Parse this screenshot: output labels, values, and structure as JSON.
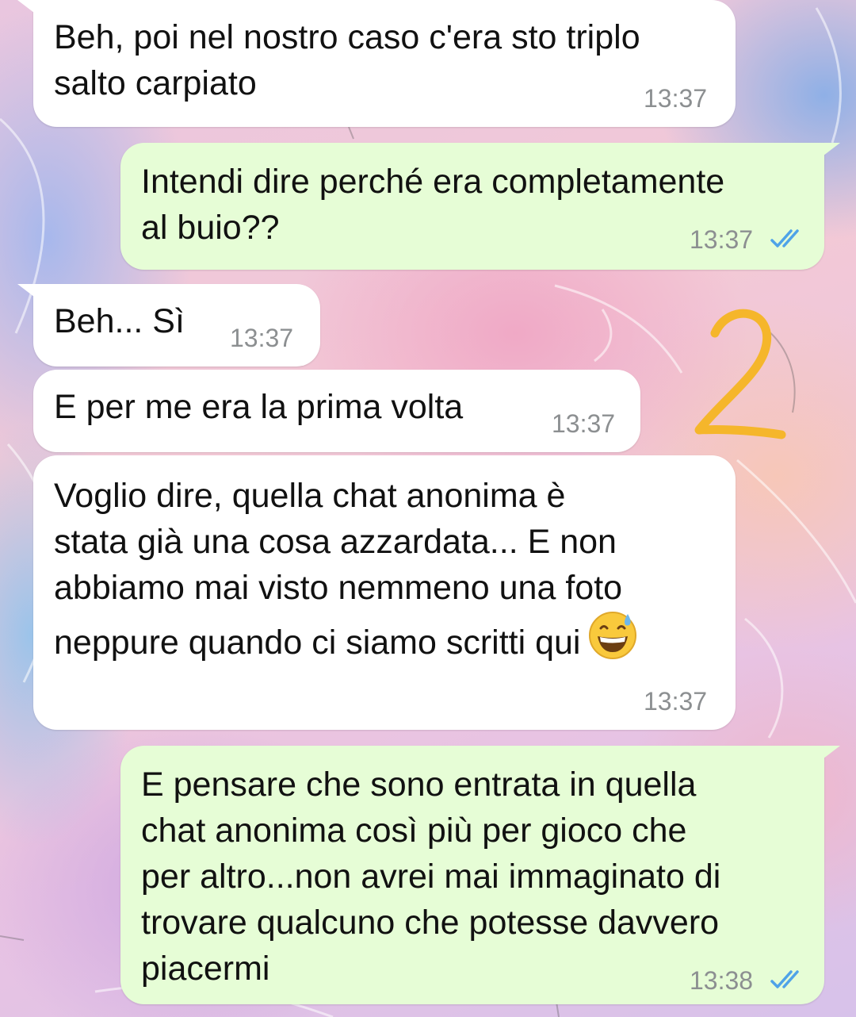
{
  "messages": [
    {
      "direction": "incoming",
      "text": "Beh, poi nel nostro caso c'era sto triplo\nsalto carpiato",
      "time": "13:37"
    },
    {
      "direction": "outgoing",
      "text": "Intendi dire perché era completamente\nal buio??",
      "time": "13:37",
      "status": "read"
    },
    {
      "direction": "incoming",
      "text": "Beh... Sì",
      "time": "13:37"
    },
    {
      "direction": "incoming",
      "text": "E per me era la prima volta",
      "time": "13:37"
    },
    {
      "direction": "incoming",
      "text": "Voglio dire, quella chat anonima è\nstata già una cosa azzardata... E non\nabbiamo mai visto nemmeno una foto\nneppure quando ci siamo scritti qui",
      "emoji": "grinning-face-with-sweat",
      "time": "13:37"
    },
    {
      "direction": "outgoing",
      "text": "E pensare che sono entrata in quella\nchat anonima così più per gioco che\nper altro...non avrei mai immaginato di\ntrovare qualcuno che potesse davvero\npiacermi",
      "time": "13:38",
      "status": "read"
    }
  ],
  "annotation": {
    "text": "2",
    "color": "#f5b62b"
  },
  "colors": {
    "incoming_bubble": "#ffffff",
    "outgoing_bubble": "#e6fdd6",
    "read_ticks": "#4fa3e8",
    "timestamp": "#8c8f91"
  },
  "icons": [
    "double-check-read-icon",
    "grinning-face-with-sweat-emoji"
  ]
}
